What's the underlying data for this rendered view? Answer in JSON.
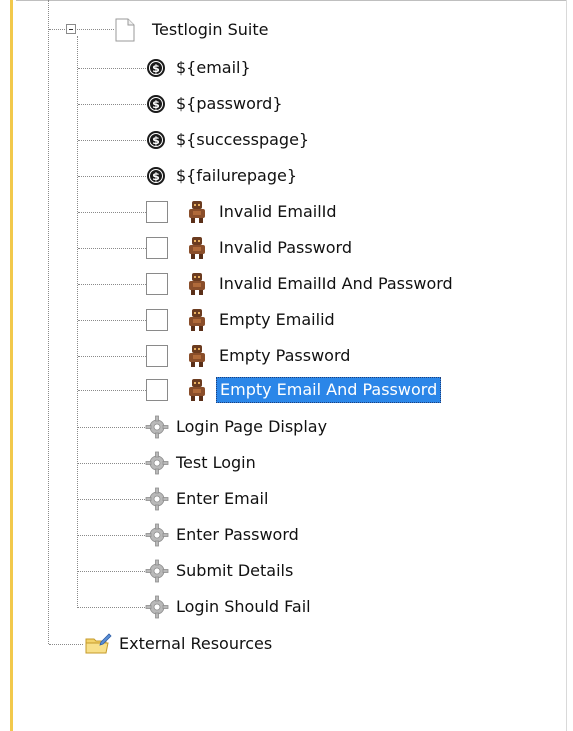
{
  "suite": {
    "label": "Testlogin Suite"
  },
  "variables": [
    {
      "label": "${email}"
    },
    {
      "label": "${password}"
    },
    {
      "label": "${successpage}"
    },
    {
      "label": "${failurepage}"
    }
  ],
  "tests": [
    {
      "label": "Invalid EmailId",
      "selected": false
    },
    {
      "label": "Invalid Password",
      "selected": false
    },
    {
      "label": "Invalid EmailId And Password",
      "selected": false
    },
    {
      "label": "Empty Emailid",
      "selected": false
    },
    {
      "label": "Empty Password",
      "selected": false
    },
    {
      "label": "Empty Email And Password",
      "selected": true
    }
  ],
  "keywords": [
    {
      "label": "Login Page Display"
    },
    {
      "label": "Test Login"
    },
    {
      "label": "Enter Email"
    },
    {
      "label": "Enter Password"
    },
    {
      "label": "Submit Details"
    },
    {
      "label": "Login Should Fail"
    }
  ],
  "external": {
    "label": "External Resources"
  },
  "colors": {
    "selection": "#2b86e8",
    "left_bar": "#f2c94c"
  },
  "icons": {
    "suite": "file-icon",
    "variable": "dollar-icon",
    "test": "robot-icon",
    "keyword": "gear-icon",
    "external": "folder-edit-icon"
  }
}
